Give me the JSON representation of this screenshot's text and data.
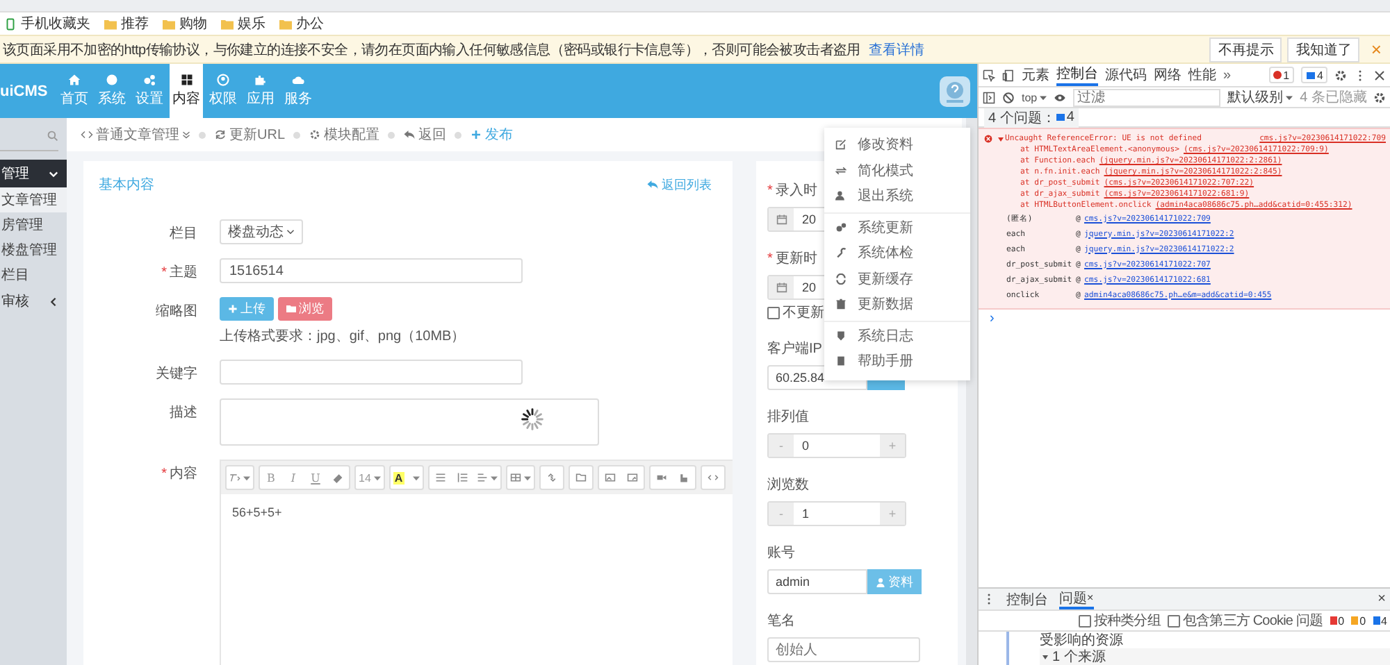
{
  "browser": {
    "bookmarks": [
      {
        "label": "手机收藏夹",
        "kind": "mobile"
      },
      {
        "label": "推荐",
        "kind": "folder"
      },
      {
        "label": "购物",
        "kind": "folder"
      },
      {
        "label": "娱乐",
        "kind": "folder"
      },
      {
        "label": "办公",
        "kind": "folder"
      }
    ],
    "security_bar": {
      "message": "该页面采用不加密的http传输协议，与你建立的连接不安全，请勿在页面内输入任何敏感信息（密码或银行卡信息等），否则可能会被攻击者盗用",
      "link": "查看详情",
      "buttons": [
        "不再提示",
        "我知道了"
      ],
      "close": "×"
    }
  },
  "header": {
    "logo": "uiCMS",
    "nav": [
      {
        "label": "首页",
        "selected": false
      },
      {
        "label": "系统",
        "selected": false
      },
      {
        "label": "设置",
        "selected": false
      },
      {
        "label": "内容",
        "selected": true
      },
      {
        "label": "权限",
        "selected": false
      },
      {
        "label": "应用",
        "selected": false
      },
      {
        "label": "服务",
        "selected": false
      }
    ]
  },
  "breadcrumb": [
    {
      "label": "普通文章管理",
      "kind": "menu"
    },
    {
      "label": "更新URL",
      "kind": "link"
    },
    {
      "label": "模块配置",
      "kind": "link"
    },
    {
      "label": "返回",
      "kind": "link"
    },
    {
      "label": "发布",
      "kind": "primary"
    }
  ],
  "sidebar": {
    "items": [
      {
        "label": "管理",
        "selected": true,
        "expanded": true,
        "children": [
          {
            "label": "文章管理",
            "selected": true
          },
          {
            "label": "房管理",
            "selected": false
          },
          {
            "label": "楼盘管理",
            "selected": false
          },
          {
            "label": "栏目",
            "selected": false
          }
        ]
      },
      {
        "label": "审核",
        "selected": false,
        "expanded": false
      }
    ]
  },
  "form": {
    "title": "基本内容",
    "back_link": "返回列表",
    "required_mark": "*",
    "fields": [
      {
        "label": "栏目",
        "required": false,
        "kind": "select",
        "value": "楼盘动态"
      },
      {
        "label": "主题",
        "required": true,
        "kind": "input",
        "value": "1516514"
      },
      {
        "label": "缩略图",
        "required": false,
        "kind": "upload",
        "buttons": [
          "上传",
          "浏览"
        ],
        "hint": "上传格式要求：jpg、gif、png（10MB）"
      },
      {
        "label": "关键字",
        "required": false,
        "kind": "input"
      },
      {
        "label": "描述",
        "required": false,
        "kind": "textarea",
        "loading": true
      },
      {
        "label": "内容",
        "required": true,
        "kind": "editor",
        "toolbar": {
          "bold": "B",
          "italic": "I",
          "underline": "U",
          "font_size": "14",
          "text_color": "A"
        },
        "value": "56+5+5+"
      }
    ]
  },
  "side_panel": {
    "required_mark": "*",
    "fields": [
      {
        "label": "录入时",
        "required": true,
        "kind": "date",
        "value": "20"
      },
      {
        "label": "更新时",
        "required": true,
        "kind": "date",
        "value": "20",
        "checkbox": {
          "label": "不更新",
          "checked": false
        }
      },
      {
        "label": "客户端IP",
        "required": false,
        "kind": "ip",
        "value": "60.25.84"
      },
      {
        "label": "排列值",
        "required": false,
        "kind": "stepper",
        "minus": "-",
        "value": "0",
        "plus": "+"
      },
      {
        "label": "浏览数",
        "required": false,
        "kind": "stepper",
        "minus": "-",
        "value": "1",
        "plus": "+"
      },
      {
        "label": "账号",
        "required": false,
        "kind": "account",
        "value": "admin",
        "button": "资料"
      },
      {
        "label": "笔名",
        "required": false,
        "kind": "input",
        "placeholder": "创始人"
      }
    ]
  },
  "user_menu": {
    "groups": [
      [
        "修改资料",
        "简化模式",
        "退出系统"
      ],
      [
        "系统更新",
        "系统体检",
        "更新缓存",
        "更新数据"
      ],
      [
        "系统日志",
        "帮助手册"
      ]
    ]
  },
  "devtools": {
    "tabs": [
      {
        "label": "元素",
        "selected": false
      },
      {
        "label": "控制台",
        "selected": true
      },
      {
        "label": "源代码",
        "selected": false
      },
      {
        "label": "网络",
        "selected": false
      },
      {
        "label": "性能",
        "selected": false
      }
    ],
    "more": "»",
    "error_count": "1",
    "message_count": "4",
    "context": "top",
    "filter_placeholder": "过滤",
    "level": "默认级别",
    "hidden": "4 条已隐藏",
    "issues_label": "4 个问题：",
    "issues_count": "4",
    "error": {
      "message": "Uncaught ReferenceError: UE is not defined",
      "source": "cms.js?v=20230614171022:709",
      "stack": [
        {
          "text": "at HTMLTextAreaElement.<anonymous>",
          "link": "(cms.js?v=20230614171022:709:9)"
        },
        {
          "text": "at Function.each",
          "link": "(jquery.min.js?v=20230614171022:2:2861)"
        },
        {
          "text": "at n.fn.init.each",
          "link": "(jquery.min.js?v=20230614171022:2:845)"
        },
        {
          "text": "at dr_post_submit",
          "link": "(cms.js?v=20230614171022:707:22)"
        },
        {
          "text": "at dr_ajax_submit",
          "link": "(cms.js?v=20230614171022:681:9)"
        },
        {
          "text": "at HTMLButtonElement.onclick",
          "link": "(admin4aca08686c75.ph…add&catid=0:455:312)"
        }
      ],
      "trace": [
        {
          "fn": "(匿名)",
          "at": "@",
          "link": "cms.js?v=20230614171022:709"
        },
        {
          "fn": "each",
          "at": "@",
          "link": "jquery.min.js?v=20230614171022:2"
        },
        {
          "fn": "each",
          "at": "@",
          "link": "jquery.min.js?v=20230614171022:2"
        },
        {
          "fn": "dr_post_submit",
          "at": "@",
          "link": "cms.js?v=20230614171022:707"
        },
        {
          "fn": "dr_ajax_submit",
          "at": "@",
          "link": "cms.js?v=20230614171022:681"
        },
        {
          "fn": "onclick",
          "at": "@",
          "link": "admin4aca08686c75.ph…e&m=add&catid=0:455"
        }
      ]
    },
    "prompt": "›",
    "drawer": {
      "tabs": [
        {
          "label": "控制台",
          "selected": false
        },
        {
          "label": "问题",
          "selected": true,
          "close": "×"
        }
      ],
      "close": "×",
      "options": [
        {
          "label": "按种类分组",
          "checked": false
        },
        {
          "label": "包含第三方 Cookie 问题",
          "checked": false
        }
      ],
      "counts": [
        {
          "value": "0",
          "color": "#e53935"
        },
        {
          "value": "0",
          "color": "#f5a623"
        },
        {
          "value": "4",
          "color": "#1a73e8"
        }
      ],
      "tree": [
        {
          "label": "受影响的资源"
        },
        {
          "label": "1 个来源",
          "expanded": true
        }
      ]
    }
  }
}
